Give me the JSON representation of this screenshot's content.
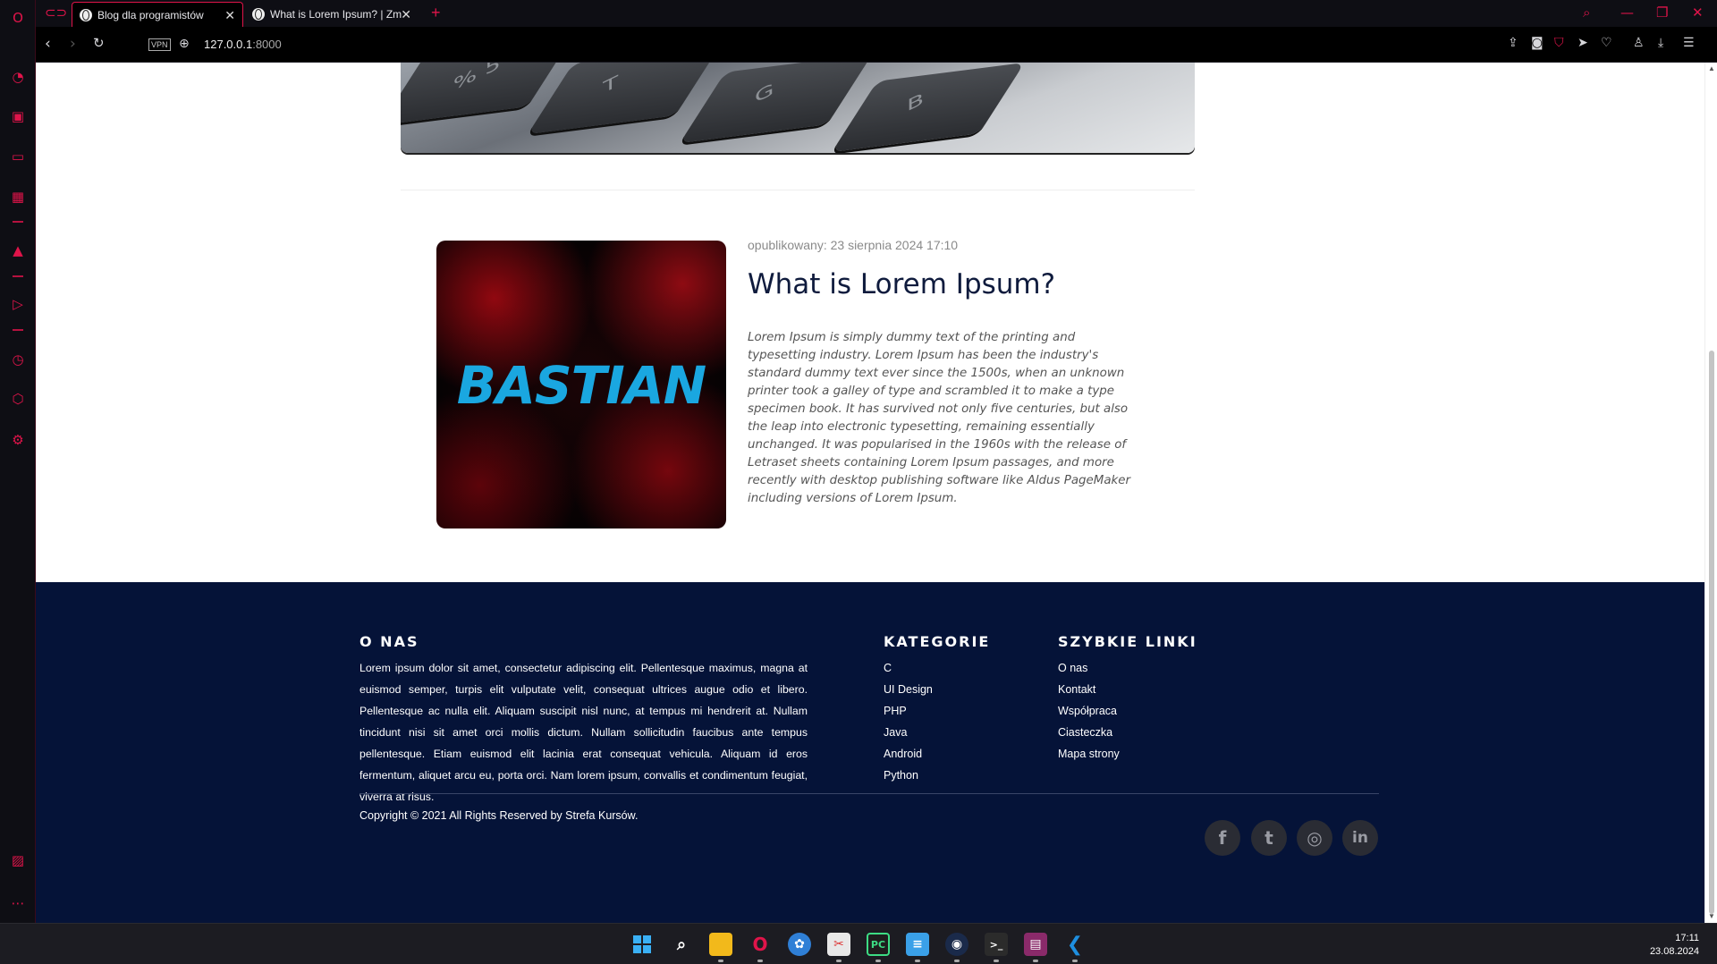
{
  "browser": {
    "tabs": [
      {
        "title": "Blog dla programistów",
        "active": true
      },
      {
        "title": "What is Lorem Ipsum? | Zm",
        "active": false
      }
    ],
    "vpn_label": "VPN",
    "url_host": "127.0.0.1",
    "url_port": ":8000",
    "accent": "#e0144a"
  },
  "post": {
    "meta": "opublikowany: 23 sierpnia 2024 17:10",
    "title": "What is Lorem Ipsum?",
    "image_text": "BASTIAN",
    "excerpt": "Lorem Ipsum is simply dummy text of the printing and typesetting industry. Lorem Ipsum has been the industry's standard dummy text ever since the 1500s, when an unknown printer took a galley of type and scrambled it to make a type specimen book. It has survived not only five centuries, but also the leap into electronic typesetting, remaining essentially unchanged. It was popularised in the 1960s with the release of Letraset sheets containing Lorem Ipsum passages, and more recently with desktop publishing software like Aldus PageMaker including versions of Lorem Ipsum."
  },
  "hero_keys": [
    "%\n5",
    "T",
    "G",
    "B"
  ],
  "footer": {
    "about_heading": "O NAS",
    "about_text": "Lorem ipsum dolor sit amet, consectetur adipiscing elit. Pellentesque maximus, magna at euismod semper, turpis elit vulputate velit, consequat ultrices augue odio et libero. Pellentesque ac nulla elit. Aliquam suscipit nisl nunc, at tempus mi hendrerit at. Nullam tincidunt nisi sit amet orci mollis dictum. Nullam sollicitudin faucibus ante tempus pellentesque. Etiam euismod elit lacinia erat consequat vehicula. Aliquam id eros fermentum, aliquet arcu eu, porta orci. Nam lorem ipsum, convallis et condimentum feugiat, viverra at risus.",
    "categories_heading": "KATEGORIE",
    "categories": [
      "C",
      "UI Design",
      "PHP",
      "Java",
      "Android",
      "Python"
    ],
    "links_heading": "SZYBKIE LINKI",
    "links": [
      "O nas",
      "Kontakt",
      "Współpraca",
      "Ciasteczka",
      "Mapa strony"
    ],
    "copyright": "Copyright © 2021 All Rights Reserved by Strefa Kursów.",
    "social": [
      {
        "icon": "facebook-icon",
        "glyph": "f"
      },
      {
        "icon": "twitter-icon",
        "glyph": "t"
      },
      {
        "icon": "dribbble-icon",
        "glyph": "◎"
      },
      {
        "icon": "linkedin-icon",
        "glyph": "in"
      }
    ],
    "bg_color": "#051338"
  },
  "taskbar": {
    "time": "17:11",
    "date": "23.08.2024"
  }
}
